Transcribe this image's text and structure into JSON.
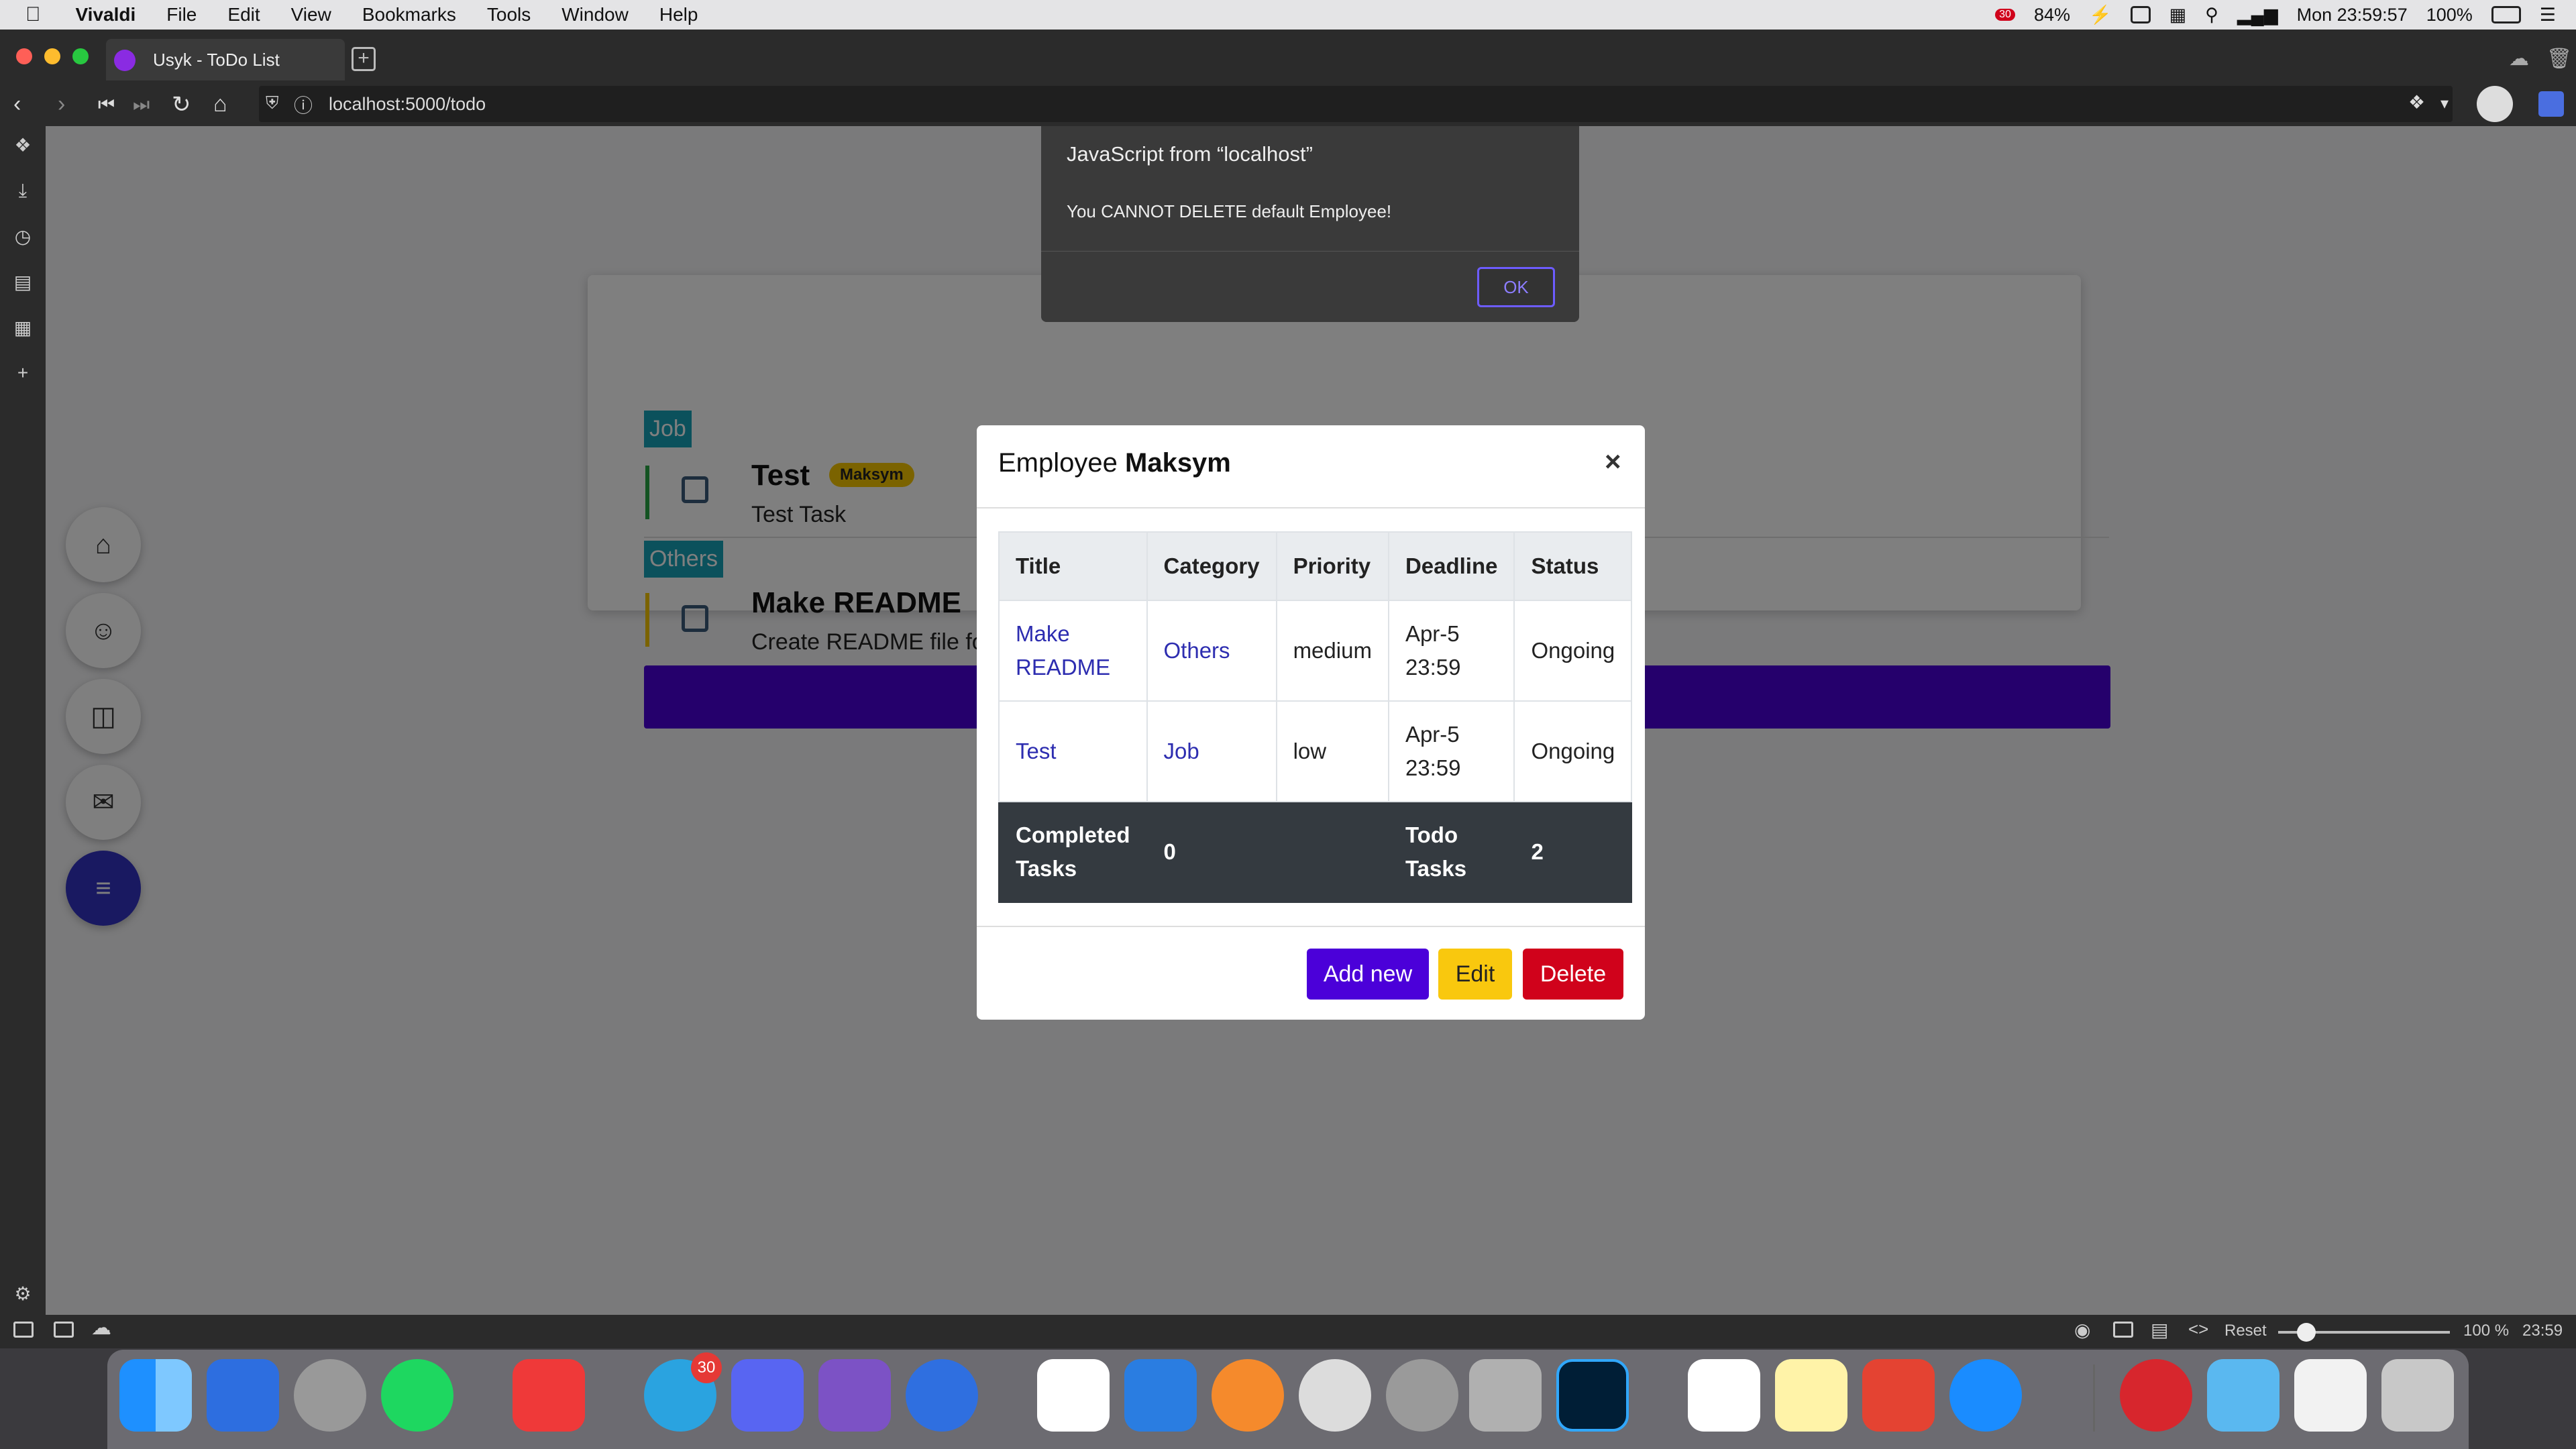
{
  "menubar": {
    "app_name": "Vivaldi",
    "menus": [
      "File",
      "Edit",
      "View",
      "Bookmarks",
      "Tools",
      "Window",
      "Help"
    ],
    "notif_badge": "30",
    "battery_pct": "84%",
    "clock": "Mon 23:59:57",
    "battery_main": "100%"
  },
  "browser": {
    "tab_title": "Usyk - ToDo List",
    "url": "localhost:5000/todo"
  },
  "alert": {
    "title": "JavaScript from “localhost”",
    "message": "You CANNOT DELETE default Employee!",
    "ok_label": "OK"
  },
  "background_page": {
    "categories": [
      {
        "label": "Job",
        "task_title": "Test",
        "owner": "Maksym",
        "desc": "Test Task"
      },
      {
        "label": "Others",
        "task_title": "Make README",
        "desc": "Create README file for"
      }
    ]
  },
  "modal": {
    "title_prefix": "Employee",
    "employee_name": "Maksym",
    "close_label": "×",
    "table": {
      "headers": [
        "Title",
        "Category",
        "Priority",
        "Deadline",
        "Status"
      ],
      "rows": [
        {
          "title": "Make README",
          "category": "Others",
          "priority": "medium",
          "deadline": "Apr-5 23:59",
          "status": "Ongoing"
        },
        {
          "title": "Test",
          "category": "Job",
          "priority": "low",
          "deadline": "Apr-5 23:59",
          "status": "Ongoing"
        }
      ],
      "footer": {
        "completed_label": "Completed Tasks",
        "completed_count": "0",
        "todo_label": "Todo Tasks",
        "todo_count": "2"
      }
    },
    "buttons": {
      "add_new": "Add new",
      "edit": "Edit",
      "delete": "Delete"
    }
  },
  "statusbar": {
    "reset_label": "Reset",
    "zoom": "100 %",
    "time": "23:59"
  },
  "dock": {
    "telegram_badge": "30"
  },
  "colors": {
    "primary": "#4b00d9",
    "warning": "#f9c80e",
    "danger": "#d0021b",
    "info": "#17a2b8",
    "nav_active": "#3333c2"
  }
}
